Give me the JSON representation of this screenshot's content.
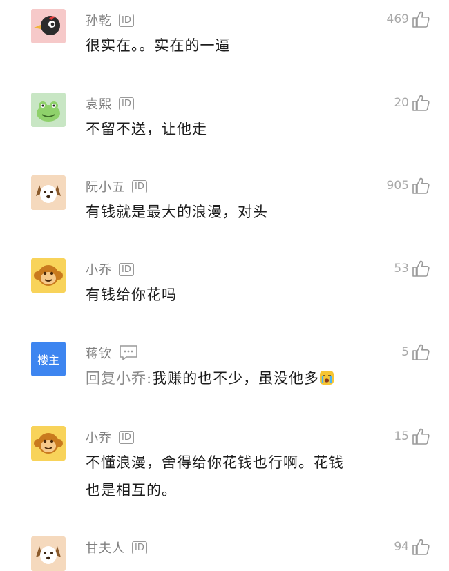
{
  "comments": [
    {
      "user": "孙乾",
      "badge": "ID",
      "likes": "469",
      "text": "很实在。。实在的一逼",
      "avatar": "woodpecker-icon"
    },
    {
      "user": "袁熙",
      "badge": "ID",
      "likes": "20",
      "text": "不留不送，让他走",
      "avatar": "frog-icon"
    },
    {
      "user": "阮小五",
      "badge": "ID",
      "likes": "905",
      "text": "有钱就是最大的浪漫，对头",
      "avatar": "dog-icon"
    },
    {
      "user": "小乔",
      "badge": "ID",
      "likes": "53",
      "text": "有钱给你花吗",
      "avatar": "monkey-icon"
    },
    {
      "user": "蒋钦",
      "host_badge": "楼主",
      "likes": "5",
      "reply_prefix": "回复小乔:",
      "text": "我赚的也不少，虽没他多",
      "avatar": "host-badge"
    },
    {
      "user": "小乔",
      "badge": "ID",
      "likes": "15",
      "text_line1": "不懂浪漫，舍得给你花钱也行啊。花钱",
      "text_line2": "也是相互的。",
      "avatar": "monkey-icon"
    },
    {
      "user": "甘夫人",
      "badge": "ID",
      "likes": "94",
      "avatar": "dog-icon"
    }
  ],
  "colors": {
    "host_blue": "#3d85f0",
    "name_gray": "#7f7f7f",
    "like_gray": "#a9a9a9"
  }
}
